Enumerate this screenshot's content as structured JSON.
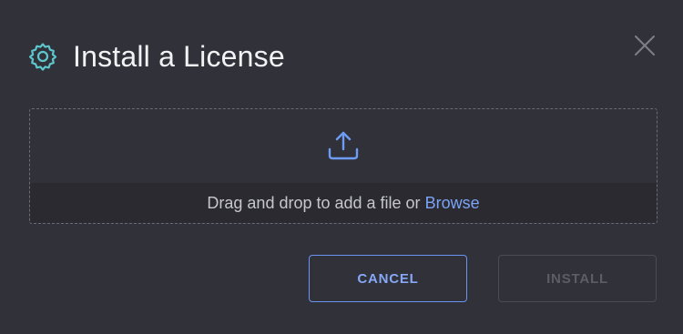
{
  "dialog": {
    "title": "Install a License",
    "icons": {
      "title_icon": "gear-icon",
      "close": "close-icon",
      "upload": "upload-icon"
    },
    "dropzone": {
      "text": "Drag and drop to add a file or",
      "browse_label": "Browse"
    },
    "buttons": {
      "cancel_label": "CANCEL",
      "install_label": "INSTALL",
      "install_disabled": true
    },
    "colors": {
      "background": "#31313a",
      "accent": "#7ba4f7",
      "gear_icon": "#5cc7cc",
      "drop_strip": "#2a2a30"
    }
  }
}
